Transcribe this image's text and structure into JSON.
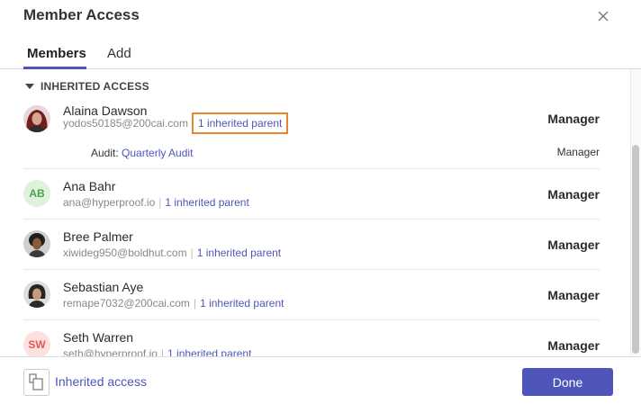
{
  "dialog": {
    "title": "Member Access"
  },
  "tabs": [
    {
      "label": "Members"
    },
    {
      "label": "Add"
    }
  ],
  "section": {
    "label": "INHERITED ACCESS"
  },
  "members": [
    {
      "name": "Alaina Dawson",
      "email": "yodos50185@200cai.com",
      "inherited": "1 inherited parent",
      "role": "Manager",
      "avatar": "photo",
      "audit": {
        "label": "Audit:",
        "link": "Quarterly Audit",
        "role": "Manager"
      }
    },
    {
      "name": "Ana Bahr",
      "email": "ana@hyperproof.io",
      "inherited": "1 inherited parent",
      "role": "Manager",
      "avatar": "initials",
      "initials": "AB"
    },
    {
      "name": "Bree Palmer",
      "email": "xiwideg950@boldhut.com",
      "inherited": "1 inherited parent",
      "role": "Manager",
      "avatar": "photo"
    },
    {
      "name": "Sebastian Aye",
      "email": "remape7032@200cai.com",
      "inherited": "1 inherited parent",
      "role": "Manager",
      "avatar": "photo"
    },
    {
      "name": "Seth Warren",
      "email": "seth@hyperproof.io",
      "inherited": "1 inherited parent",
      "role": "Manager",
      "avatar": "initials",
      "initials": "SW"
    }
  ],
  "footer": {
    "inherited_label": "Inherited access",
    "done_label": "Done"
  },
  "colors": {
    "accent": "#4f55b9",
    "highlight": "#e8862b",
    "ab_bg": "#dff3dc",
    "ab_fg": "#4aa24a",
    "sw_bg": "#fde0e0",
    "sw_fg": "#e05a5a"
  }
}
